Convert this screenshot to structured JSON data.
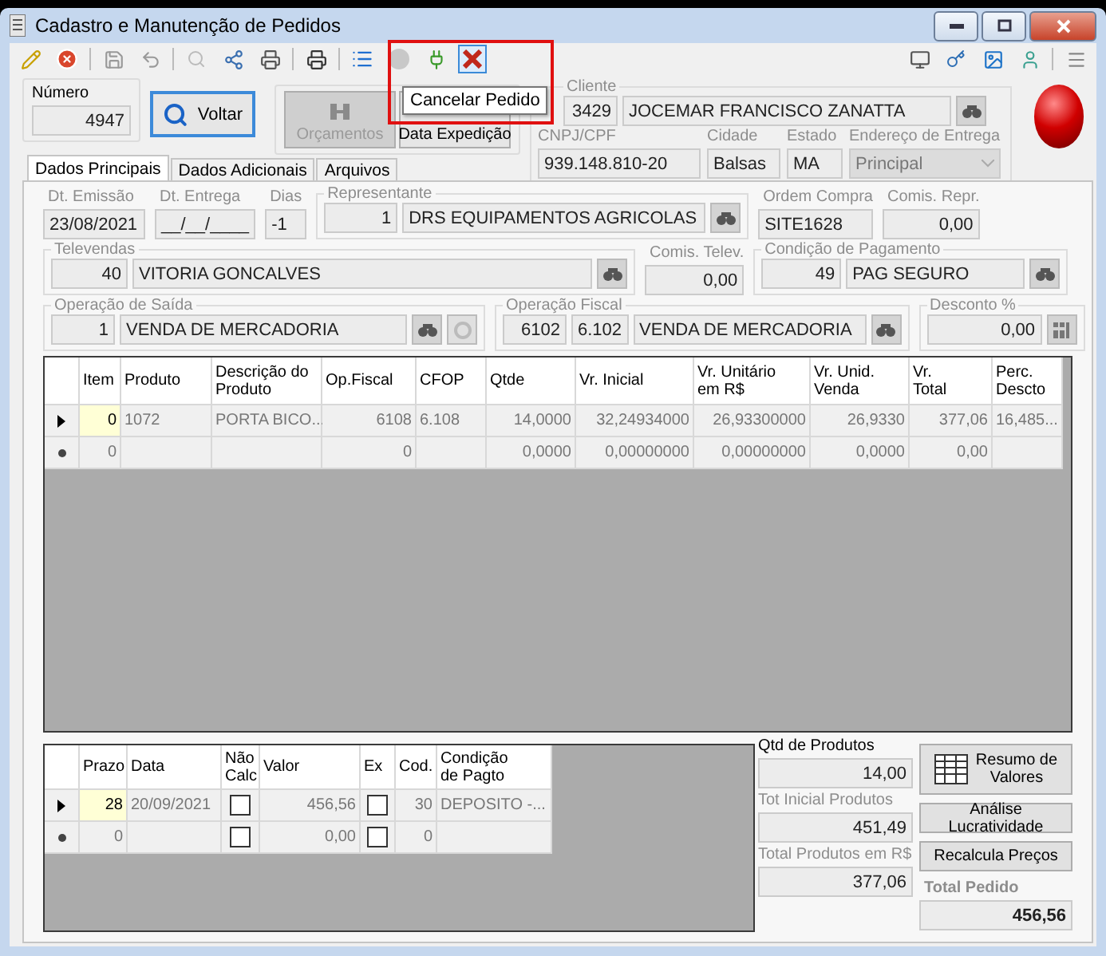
{
  "window": {
    "title": "Cadastro e Manutenção de Pedidos"
  },
  "tooltip": {
    "text": "Cancelar Pedido"
  },
  "numero": {
    "label": "Número",
    "value": "4947"
  },
  "voltar_button": {
    "label": "Voltar"
  },
  "action_buttons": [
    {
      "kind": "orcamentos",
      "label": "Orçamentos",
      "disabled": true
    },
    {
      "kind": "expedicao",
      "label": "Data Expedição",
      "disabled": false
    }
  ],
  "cliente": {
    "label": "Cliente",
    "code": "3429",
    "name": "JOCEMAR FRANCISCO ZANATTA"
  },
  "cliente_details": [
    {
      "label": "CNPJ/CPF",
      "value": "939.148.810-20"
    },
    {
      "label": "Cidade",
      "value": "Balsas"
    },
    {
      "label": "Estado",
      "value": "MA"
    },
    {
      "label": "Endereço de Entrega",
      "value": "Principal"
    }
  ],
  "tabs": [
    {
      "label": "Dados Principais",
      "selected": true
    },
    {
      "label": "Dados Adicionais",
      "selected": false
    },
    {
      "label": "Arquivos",
      "selected": false
    }
  ],
  "main_rows": [
    [
      {
        "kind": "field",
        "label": "Dt. Emissão",
        "value": "23/08/2021"
      },
      {
        "kind": "field",
        "label": "Dt. Entrega",
        "value": "__/__/____"
      },
      {
        "kind": "field",
        "label": "Dias",
        "value": "-1"
      },
      {
        "kind": "group",
        "label": "Representante",
        "values": [
          "1",
          "DRS EQUIPAMENTOS AGRICOLAS"
        ]
      },
      {
        "kind": "field",
        "label": "Ordem Compra",
        "value": "SITE1628"
      },
      {
        "kind": "field",
        "label": "Comis. Repr.",
        "value": "0,00"
      }
    ],
    [
      {
        "kind": "group",
        "label": "Televendas",
        "values": [
          "40",
          "VITORIA GONCALVES"
        ]
      },
      {
        "kind": "field",
        "label": "Comis. Telev.",
        "value": "0,00"
      },
      {
        "kind": "group",
        "label": "Condição de Pagamento",
        "values": [
          "49",
          "PAG SEGURO"
        ]
      }
    ],
    [
      {
        "kind": "group",
        "label": "Operação de Saída",
        "values": [
          "1",
          "VENDA DE MERCADORIA"
        ]
      },
      {
        "kind": "group",
        "label": "Operação Fiscal",
        "values": [
          "6102",
          "6.102",
          "VENDA DE MERCADORIA"
        ]
      },
      {
        "kind": "group",
        "label": "Desconto %",
        "values": [
          "0,00"
        ]
      }
    ]
  ],
  "items_table": {
    "columns": [
      "Item",
      "Produto",
      "Descrição do\nProduto",
      "Op.Fiscal",
      "CFOP",
      "Qtde",
      "Vr. Inicial",
      "Vr. Unitário\nem R$",
      "Vr. Unid.\nVenda",
      "Vr.\nTotal",
      "Perc.\nDescto"
    ],
    "rows": [
      {
        "selected": true,
        "cells": [
          "0",
          "1072",
          "PORTA BICO...",
          "6108",
          "6.108",
          "14,0000",
          "32,24934000",
          "26,93300000",
          "26,9330",
          "377,06",
          "16,485..."
        ]
      },
      {
        "selected": false,
        "cells": [
          "0",
          null,
          null,
          "0",
          null,
          "0,0000",
          "0,00000000",
          "0,00000000",
          "0,0000",
          "0,00",
          null
        ]
      }
    ]
  },
  "payments_table": {
    "columns": [
      "Prazo",
      "Data",
      "Não\nCalc",
      "Valor",
      "Ex",
      "Cod.",
      "Condição\nde Pagto"
    ],
    "rows": [
      {
        "selected": true,
        "cells": [
          "28",
          "20/09/2021",
          {
            "checked": false
          },
          "456,56",
          {
            "checked": false
          },
          "30",
          "DEPOSITO -..."
        ]
      },
      {
        "selected": false,
        "cells": [
          "0",
          null,
          {
            "checked": false
          },
          "0,00",
          {
            "checked": false
          },
          "0",
          null
        ]
      }
    ]
  },
  "summary_fields": [
    {
      "label": "Qtd de Produtos",
      "value": "14,00",
      "disabled": false
    },
    {
      "label": "Tot Inicial Produtos",
      "value": "451,49",
      "disabled": true
    },
    {
      "label": "Total Produtos em R$",
      "value": "377,06",
      "disabled": true
    }
  ],
  "summary_buttons": [
    {
      "label": "Resumo de\nValores",
      "kind": "resumo"
    },
    {
      "label": "Análise Lucratividade",
      "kind": "plain"
    },
    {
      "label": "Recalcula Preços",
      "kind": "plain"
    }
  ],
  "total": {
    "label": "Total Pedido",
    "value": "456,56"
  }
}
